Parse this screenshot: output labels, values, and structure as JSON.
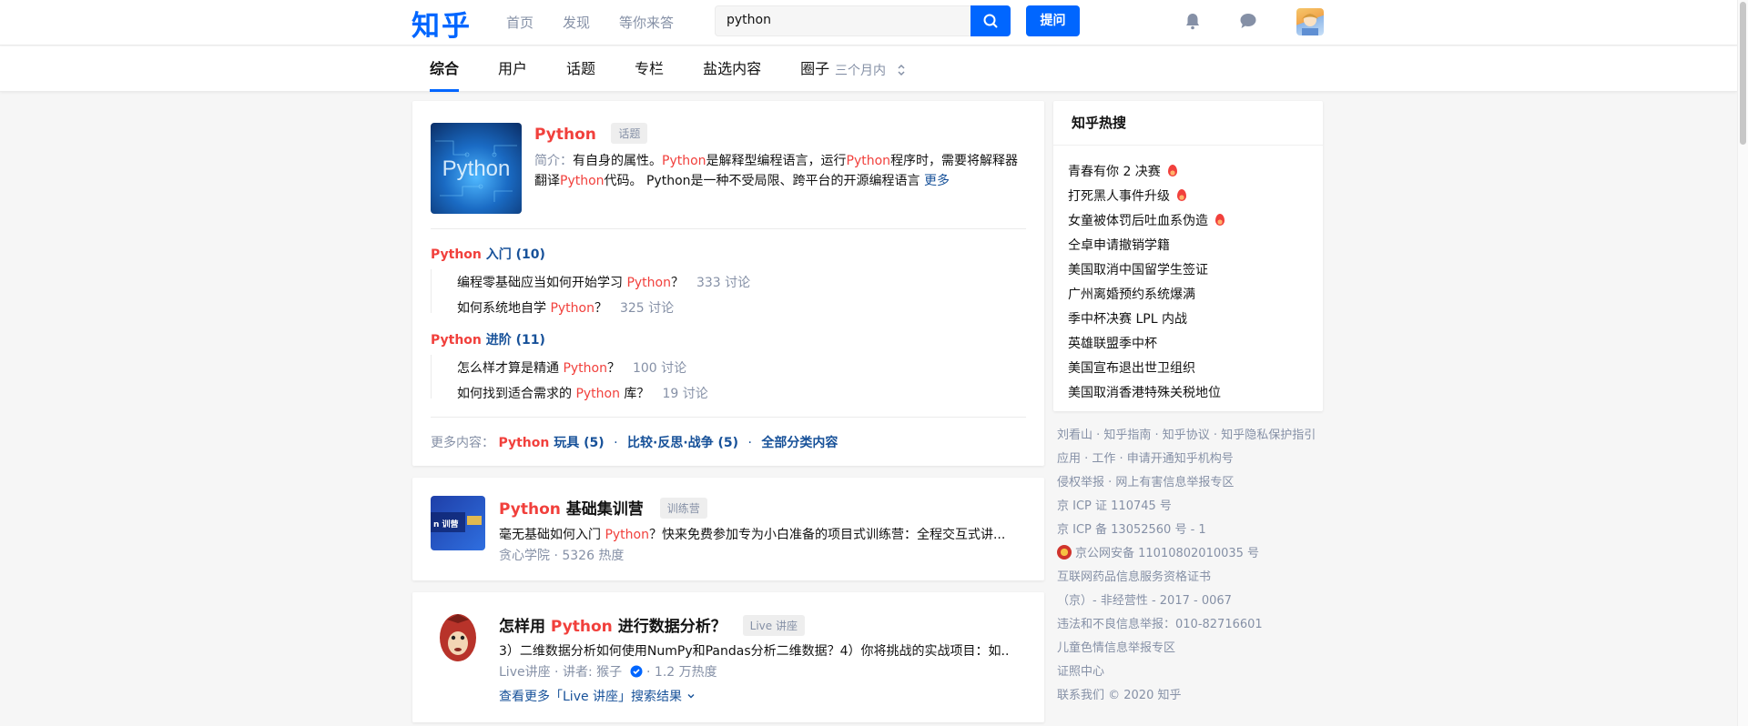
{
  "header": {
    "logo": "知乎",
    "nav": [
      "首页",
      "发现",
      "等你来答"
    ],
    "search_value": "python",
    "ask_label": "提问"
  },
  "subnav": {
    "tabs": [
      "综合",
      "用户",
      "话题",
      "专栏",
      "盐选内容",
      "圈子"
    ],
    "active_tab": "综合",
    "range": "三个月内"
  },
  "topic_card": {
    "thumb_text": "Python",
    "title": "Python",
    "tag": "话题",
    "intro_label": "简介：",
    "intro_parts": [
      "有自身的属性。",
      "Python",
      "是解释型编程语言，运行",
      "Python",
      "程序时，需要将解释器翻译",
      "Python",
      "代码。 Python是一种不受局限、跨平台的开源编程语言"
    ],
    "more": "更多",
    "sections": [
      {
        "title_hl": "Python",
        "title_rest": " 入门 (10)",
        "questions": [
          {
            "pre": "编程零基础应当如何开始学习 ",
            "hl": "Python",
            "post": "？",
            "count": "333 讨论"
          },
          {
            "pre": "如何系统地自学 ",
            "hl": "Python",
            "post": "？",
            "count": "325 讨论"
          }
        ]
      },
      {
        "title_hl": "Python",
        "title_rest": " 进阶 (11)",
        "questions": [
          {
            "pre": "怎么样才算是精通 ",
            "hl": "Python",
            "post": "？",
            "count": "100 讨论"
          },
          {
            "pre": "如何找到适合需求的 ",
            "hl": "Python",
            "post": " 库？",
            "count": "19 讨论"
          }
        ]
      }
    ],
    "more_label": "更多内容：",
    "more_links": [
      {
        "hl": "Python",
        "rest": " 玩具 (5)"
      },
      {
        "hl": "",
        "rest": "比较·反思·战争 (5)"
      },
      {
        "hl": "",
        "rest": "全部分类内容"
      }
    ],
    "separator": "·"
  },
  "camp_card": {
    "thumb_text": "n 训营",
    "title_hl": "Python",
    "title_rest": " 基础集训营",
    "tag": "训练营",
    "desc_pre": "毫无基础如何入门 ",
    "desc_hl": "Python",
    "desc_post": "？快来免费参加专为小白准备的项目式训练营：全程交互式讲...",
    "meta": "贪心学院 · 5326 热度"
  },
  "live_card": {
    "title_pre": "怎样用 ",
    "title_hl": "Python",
    "title_post": " 进行数据分析？",
    "tag": "Live 讲座",
    "desc": "3）二维数据分析如何使用NumPy和Pandas分析二维数据？4）你将挑战的实战项目：如...",
    "meta_pre": "Live讲座 · 讲者: 猴子",
    "meta_post": " · 1.2 万热度",
    "see_more": "查看更多「Live 讲座」搜索结果"
  },
  "hot_search": {
    "title": "知乎热搜",
    "items": [
      {
        "text": "青春有你 2 决赛",
        "hot": true
      },
      {
        "text": "打死黑人事件升级",
        "hot": true
      },
      {
        "text": "女童被体罚后吐血系伪造",
        "hot": true
      },
      {
        "text": "仝卓申请撤销学籍",
        "hot": false
      },
      {
        "text": "美国取消中国留学生签证",
        "hot": false
      },
      {
        "text": "广州离婚预约系统爆满",
        "hot": false
      },
      {
        "text": "季中杯决赛 LPL 内战",
        "hot": false
      },
      {
        "text": "英雄联盟季中杯",
        "hot": false
      },
      {
        "text": "美国宣布退出世卫组织",
        "hot": false
      },
      {
        "text": "美国取消香港特殊关税地位",
        "hot": false
      }
    ]
  },
  "footer": {
    "lines": [
      "刘看山 · 知乎指南 · 知乎协议 · 知乎隐私保护指引",
      "应用 · 工作 · 申请开通知乎机构号",
      "侵权举报 · 网上有害信息举报专区",
      "京 ICP 证 110745 号",
      "京 ICP 备 13052560 号 - 1",
      "京公网安备 11010802010035 号",
      "互联网药品信息服务资格证书",
      "（京）- 非经营性 - 2017 - 0067",
      "违法和不良信息举报：010-82716601",
      "儿童色情信息举报专区",
      "证照中心",
      "联系我们 © 2020 知乎"
    ]
  },
  "colors": {
    "brand": "#0066ff",
    "highlight": "#f1403c",
    "link": "#175199",
    "muted": "#8590a6"
  }
}
